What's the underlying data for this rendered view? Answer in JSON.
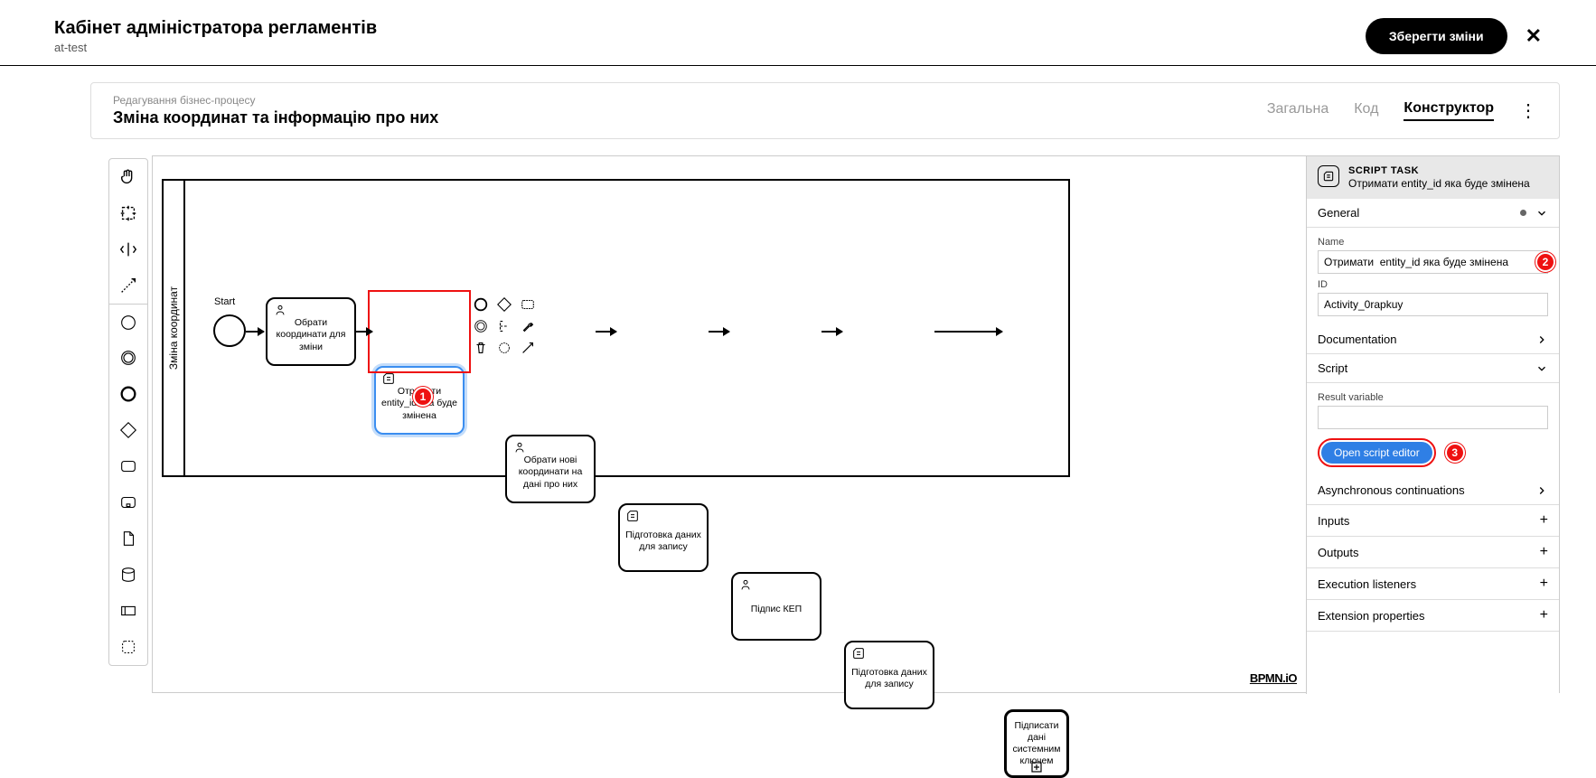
{
  "header": {
    "title": "Кабінет адміністратора регламентів",
    "subtitle": "at-test",
    "save_btn": "Зберегти зміни"
  },
  "edit": {
    "breadcrumb": "Редагування бізнес-процесу",
    "title": "Зміна координат та інформацію про них",
    "tabs": {
      "general": "Загальна",
      "code": "Код",
      "constructor": "Конструктор"
    }
  },
  "pool": {
    "lane_label": "Зміна координат"
  },
  "nodes": {
    "start": {
      "label": "Start"
    },
    "task1": {
      "label": "Обрати координати для зміни"
    },
    "task2": {
      "label": "Отримати entity_id яка буде змінена"
    },
    "task3": {
      "label": "Обрати нові координати на дані про них"
    },
    "task4": {
      "label": "Підготовка даних для запису"
    },
    "task5": {
      "label": "Підпис КЕП"
    },
    "task6": {
      "label": "Підготовка даних для запису"
    },
    "task7": {
      "label": "Підписати дані системним ключем"
    }
  },
  "props": {
    "type": "SCRIPT TASK",
    "element_name": "Отримати entity_id яка буде змінена",
    "sections": {
      "general": "General",
      "documentation": "Documentation",
      "script": "Script",
      "async": "Asynchronous continuations",
      "inputs": "Inputs",
      "outputs": "Outputs",
      "listeners": "Execution listeners",
      "extension": "Extension properties"
    },
    "labels": {
      "name": "Name",
      "id": "ID",
      "result_var": "Result variable"
    },
    "values": {
      "name": "Отримати  entity_id яка буде змінена",
      "id": "Activity_0rapkuy",
      "result_var": ""
    },
    "open_script": "Open script editor"
  },
  "callouts": {
    "c1": "1",
    "c2": "2",
    "c3": "3"
  },
  "logo": "BPMN.iO"
}
